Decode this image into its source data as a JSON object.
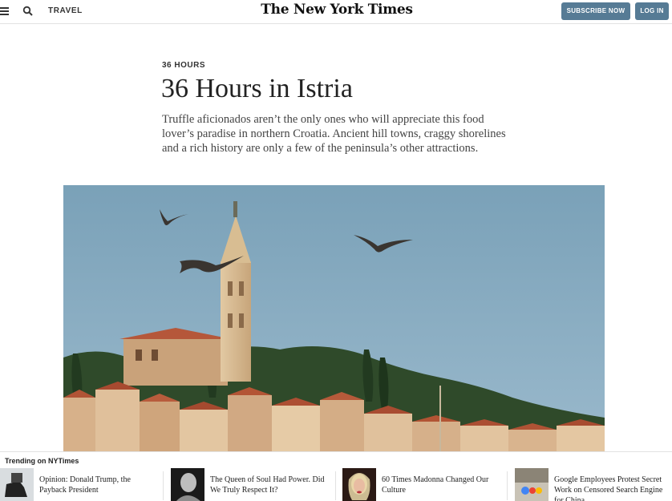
{
  "header": {
    "section": "TRAVEL",
    "masthead": "The New York Times",
    "subscribe_label": "SUBSCRIBE NOW",
    "login_label": "LOG IN",
    "brand_button_color": "#567b95"
  },
  "article": {
    "kicker": "36 HOURS",
    "headline": "36 Hours in Istria",
    "summary": "Truffle aficionados aren’t the only ones who will appreciate this food lover’s paradise in northern Croatia. Ancient hill towns, craggy shorelines and a rich history are only a few of the peninsula’s other attractions."
  },
  "trending": {
    "title": "Trending on NYTimes",
    "items": [
      {
        "label": "Opinion: Donald Trump, the Payback President"
      },
      {
        "label": "The Queen of Soul Had Power. Did We Truly Respect It?"
      },
      {
        "label": "60 Times Madonna Changed Our Culture"
      },
      {
        "label": "Google Employees Protest Secret Work on Censored Search Engine for China"
      }
    ]
  }
}
